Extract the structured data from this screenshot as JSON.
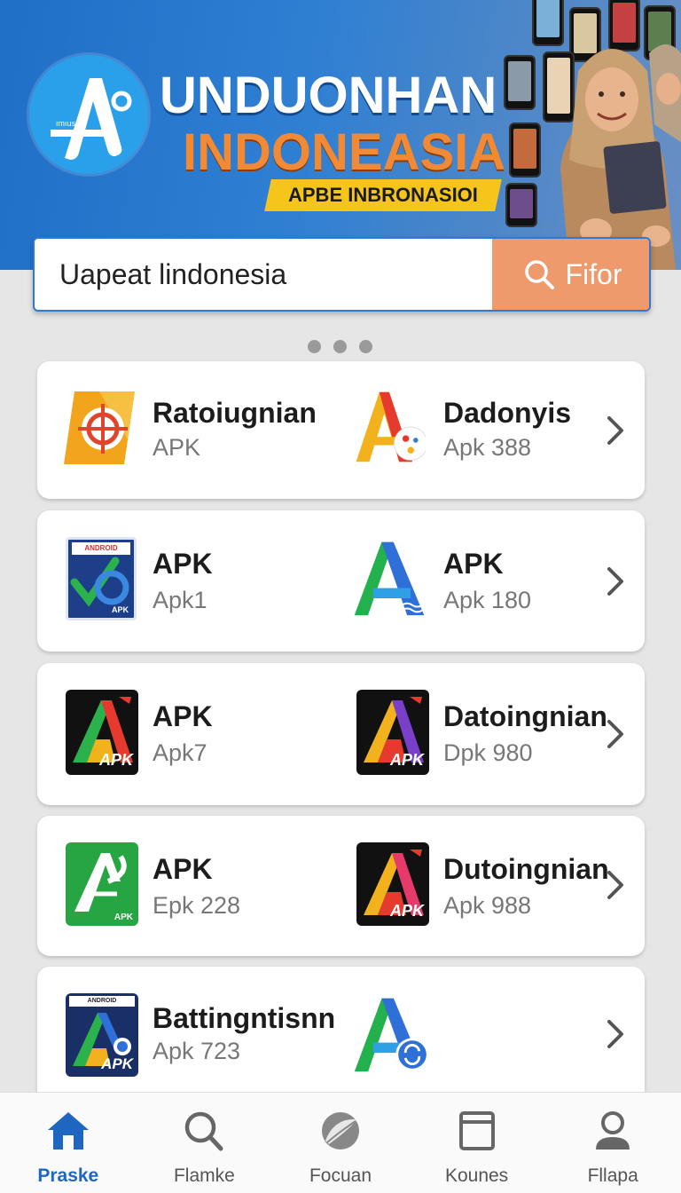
{
  "banner": {
    "title": "UNDUONHAN",
    "subtitle": "INDONEASIA",
    "tag": "APBE INBRONASIOI",
    "logo_label": "ımıus"
  },
  "search": {
    "value": "Uapeat lindonesia",
    "filter_label": "Fifor"
  },
  "cards": [
    {
      "left": {
        "name": "Ratoiugnian",
        "sub": "APK",
        "icon": "orange-target-app-icon"
      },
      "right": {
        "name": "Dadonyis",
        "sub": "Apk 388",
        "icon": "colorful-a-app-icon"
      }
    },
    {
      "left": {
        "name": "APK",
        "sub": "Apk1",
        "icon": "blue-check-apk-icon",
        "icon_text": "APK",
        "icon_top": "ANDROID"
      },
      "right": {
        "name": "APK",
        "sub": "Apk 180",
        "icon": "green-blue-a-app-icon"
      }
    },
    {
      "left": {
        "name": "APK",
        "sub": "Apk7",
        "icon": "dark-rainbow-apk-icon",
        "icon_text": "APK"
      },
      "right": {
        "name": "Datoingnian",
        "sub": "Dpk 980",
        "icon": "dark-purple-apk-icon",
        "icon_text": "APK"
      }
    },
    {
      "left": {
        "name": "APK",
        "sub": "Epk 228",
        "icon": "green-apk-icon",
        "icon_text": "APK"
      },
      "right": {
        "name": "Dutoingnian",
        "sub": "Apk 988",
        "icon": "dark-red-apk-icon",
        "icon_text": "APK"
      }
    },
    {
      "left": {
        "name": "Battingntisnn",
        "sub": "Apk 723",
        "icon": "navy-apk-icon",
        "icon_text": "APK",
        "icon_top": "ANDROID"
      },
      "right": {
        "name": "",
        "sub": "",
        "icon": "a-sync-app-icon"
      }
    }
  ],
  "nav": [
    {
      "label": "Praske",
      "icon": "home-icon",
      "active": true
    },
    {
      "label": "Flamke",
      "icon": "search-icon",
      "active": false
    },
    {
      "label": "Focuan",
      "icon": "leaf-globe-icon",
      "active": false
    },
    {
      "label": "Kounes",
      "icon": "window-icon",
      "active": false
    },
    {
      "label": "Fllapa",
      "icon": "person-icon",
      "active": false
    }
  ],
  "colors": {
    "banner": "#1f6fc8",
    "accent_orange": "#ee9a6c",
    "nav_active": "#1f66c0",
    "tag_yellow": "#f5c51c"
  }
}
